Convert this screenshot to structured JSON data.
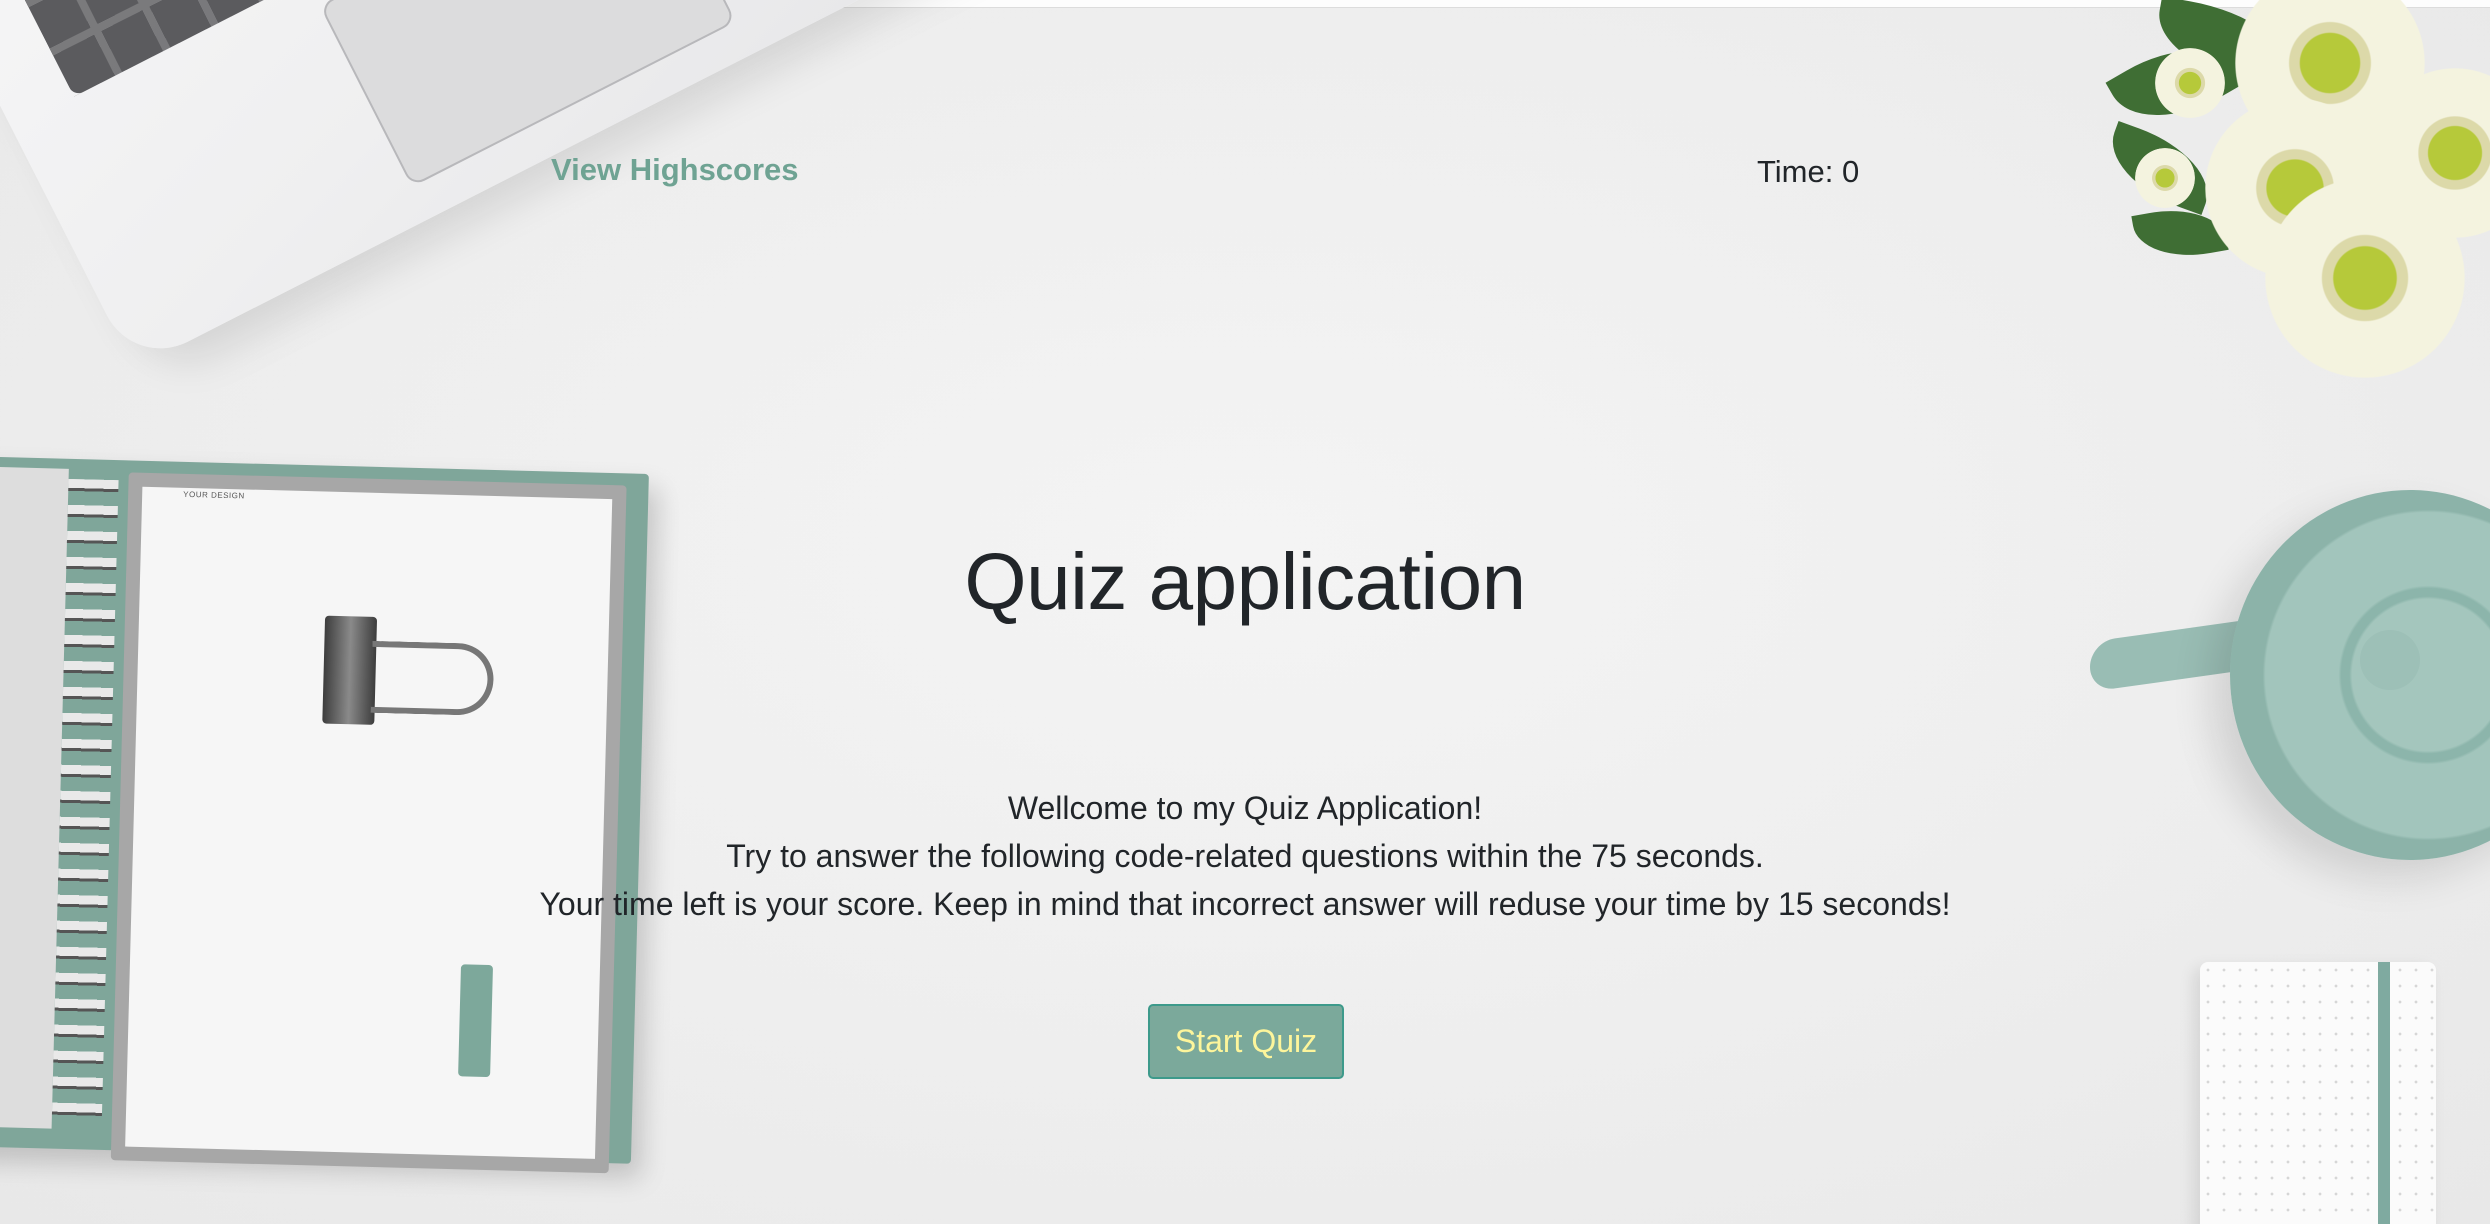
{
  "header": {
    "highscores_link": "View Highscores",
    "timer_label": "Time: 0"
  },
  "main": {
    "title": "Quiz application",
    "intro_lines": [
      "Wellcome to my Quiz Application!",
      "Try to answer the following code-related questions within the 75 seconds.",
      "Your time left is your score. Keep in mind that incorrect answer will reduse your time by 15 seconds!"
    ],
    "start_button": "Start Quiz"
  },
  "background": {
    "notebook_label": "YOUR DESIGN"
  },
  "colors": {
    "accent": "#6fa393",
    "button_bg": "#7ba99b",
    "button_text": "#fdf59b",
    "text": "#212529",
    "page_bg": "#eeeeee"
  }
}
